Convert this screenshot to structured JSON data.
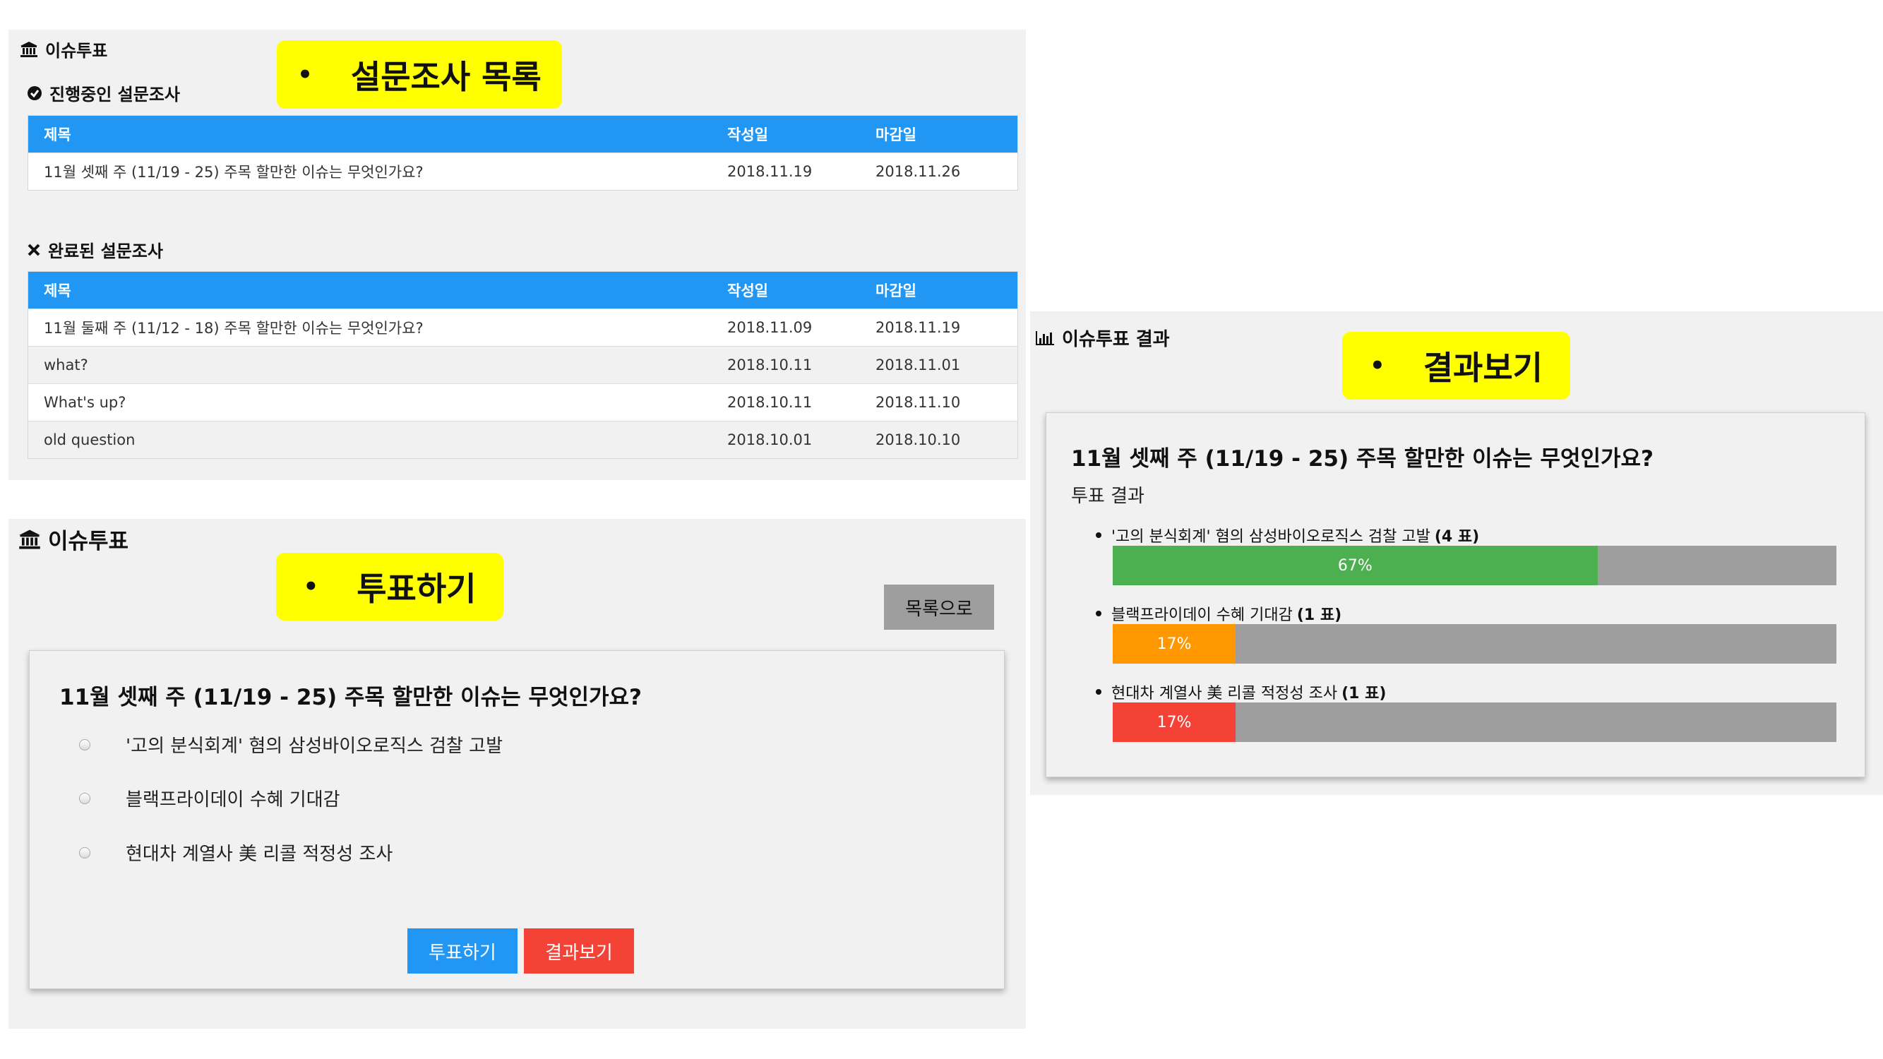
{
  "list_panel": {
    "title": "이슈투표",
    "callout": "설문조사 목록",
    "bullet": "•",
    "ongoing": {
      "heading": "진행중인 설문조사",
      "columns": [
        "제목",
        "작성일",
        "마감일"
      ],
      "rows": [
        {
          "title": "11월 셋째 주 (11/19 - 25) 주목 할만한 이슈는 무엇인가요?",
          "created": "2018.11.19",
          "deadline": "2018.11.26"
        }
      ]
    },
    "completed": {
      "heading": "완료된 설문조사",
      "columns": [
        "제목",
        "작성일",
        "마감일"
      ],
      "rows": [
        {
          "title": "11월 둘째 주 (11/12 - 18) 주목 할만한 이슈는 무엇인가요?",
          "created": "2018.11.09",
          "deadline": "2018.11.19"
        },
        {
          "title": "what?",
          "created": "2018.10.11",
          "deadline": "2018.11.01"
        },
        {
          "title": "What's up?",
          "created": "2018.10.11",
          "deadline": "2018.11.10"
        },
        {
          "title": "old question",
          "created": "2018.10.01",
          "deadline": "2018.10.10"
        }
      ]
    }
  },
  "vote_panel": {
    "title": "이슈투표",
    "callout": "투표하기",
    "bullet": "•",
    "back_button": "목록으로",
    "question": "11월 셋째 주 (11/19 - 25) 주목 할만한 이슈는 무엇인가요?",
    "options": [
      "'고의 분식회계' 혐의 삼성바이오로직스 검찰 고발",
      "블랙프라이데이 수혜 기대감",
      "현대차 계열사 美 리콜 적정성 조사"
    ],
    "vote_button": "투표하기",
    "result_button": "결과보기"
  },
  "result_panel": {
    "title": "이슈투표 결과",
    "callout": "결과보기",
    "bullet": "•",
    "question": "11월 셋째 주 (11/19 - 25) 주목 할만한 이슈는 무엇인가요?",
    "subtitle": "투표 결과",
    "results": [
      {
        "label": "'고의 분식회계' 혐의 삼성바이오로직스 검찰 고발",
        "count": "(4 표)",
        "percent": 67,
        "percent_label": "67%",
        "color": "#4caf50"
      },
      {
        "label": "블랙프라이데이 수혜 기대감",
        "count": "(1 표)",
        "percent": 17,
        "percent_label": "17%",
        "color": "#ff9800"
      },
      {
        "label": "현대차 계열사 美 리콜 적정성 조사",
        "count": "(1 표)",
        "percent": 17,
        "percent_label": "17%",
        "color": "#f44336"
      }
    ]
  },
  "colors": {
    "callout": "#ffff00",
    "table_header": "#2196f3",
    "panel_bg": "#f1f1f1",
    "bar_track": "#9e9e9e",
    "vote_button": "#2196f3",
    "result_button": "#f44336",
    "back_button": "#9e9e9e"
  }
}
